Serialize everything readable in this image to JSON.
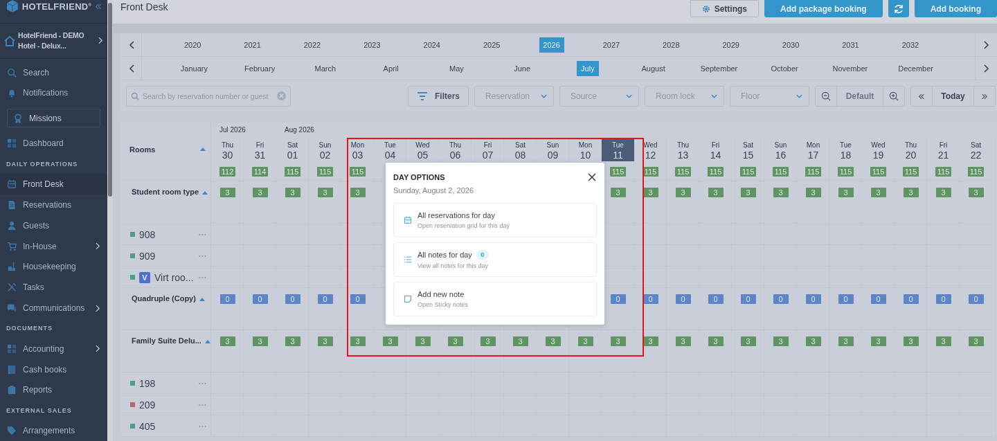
{
  "sidebar": {
    "brand": "HOTELFRIEND$^{®}$",
    "hotel": "HotelFriend - DEMO Hotel - Delux...",
    "items": [
      {
        "kind": "link",
        "label": "Search",
        "selected": false,
        "submenu": false
      },
      {
        "kind": "link",
        "label": "Notifications",
        "selected": false,
        "submenu": false
      },
      {
        "kind": "feature",
        "label": "Missions",
        "selected": false,
        "submenu": false
      },
      {
        "kind": "link",
        "label": "Dashboard",
        "selected": false,
        "submenu": false
      },
      {
        "kind": "heading",
        "label": "DAILY OPERATIONS"
      },
      {
        "kind": "link",
        "label": "Front Desk",
        "selected": true,
        "submenu": false
      },
      {
        "kind": "link",
        "label": "Reservations",
        "selected": false,
        "submenu": false
      },
      {
        "kind": "link",
        "label": "Guests",
        "selected": false,
        "submenu": false
      },
      {
        "kind": "link",
        "label": "In-House",
        "selected": false,
        "submenu": true
      },
      {
        "kind": "link",
        "label": "Housekeeping",
        "selected": false,
        "submenu": false
      },
      {
        "kind": "link",
        "label": "Tasks",
        "selected": false,
        "submenu": false
      },
      {
        "kind": "link",
        "label": "Communications",
        "selected": false,
        "submenu": true
      },
      {
        "kind": "heading",
        "label": "DOCUMENTS"
      },
      {
        "kind": "link",
        "label": "Accounting",
        "selected": false,
        "submenu": true
      },
      {
        "kind": "link",
        "label": "Cash books",
        "selected": false,
        "submenu": false
      },
      {
        "kind": "link",
        "label": "Reports",
        "selected": false,
        "submenu": false
      },
      {
        "kind": "heading",
        "label": "EXTERNAL SALES"
      },
      {
        "kind": "link",
        "label": "Arrangements",
        "selected": false,
        "submenu": false
      }
    ]
  },
  "header": {
    "title": "Front Desk",
    "buttons": [
      {
        "kind": "outline",
        "label": "Settings"
      },
      {
        "kind": "primary",
        "label": "Add package booking"
      },
      {
        "kind": "icon"
      },
      {
        "kind": "primary",
        "label": "Add booking"
      }
    ]
  },
  "years": [
    {
      "label": "2020",
      "selected": false
    },
    {
      "label": "2021",
      "selected": false
    },
    {
      "label": "2022",
      "selected": false
    },
    {
      "label": "2023",
      "selected": false
    },
    {
      "label": "2024",
      "selected": false
    },
    {
      "label": "2025",
      "selected": false
    },
    {
      "label": "2026",
      "selected": true
    },
    {
      "label": "2027",
      "selected": false
    },
    {
      "label": "2028",
      "selected": false
    },
    {
      "label": "2029",
      "selected": false
    },
    {
      "label": "2030",
      "selected": false
    },
    {
      "label": "2031",
      "selected": false
    },
    {
      "label": "2032",
      "selected": false
    }
  ],
  "months": [
    {
      "label": "January",
      "selected": false
    },
    {
      "label": "February",
      "selected": false
    },
    {
      "label": "March",
      "selected": false
    },
    {
      "label": "April",
      "selected": false
    },
    {
      "label": "May",
      "selected": false
    },
    {
      "label": "June",
      "selected": false
    },
    {
      "label": "July",
      "selected": true
    },
    {
      "label": "August",
      "selected": false
    },
    {
      "label": "September",
      "selected": false
    },
    {
      "label": "October",
      "selected": false
    },
    {
      "label": "November",
      "selected": false
    },
    {
      "label": "December",
      "selected": false
    }
  ],
  "filters": {
    "search": {
      "placeholder": "Search by reservation number or guest"
    },
    "filter_button": "Filters",
    "dropdowns": [
      {
        "placeholder": "Reservation"
      },
      {
        "placeholder": "Source"
      },
      {
        "placeholder": "Room lock"
      },
      {
        "placeholder": "Floor"
      }
    ],
    "zoom_label": "Default",
    "today_label": "Today"
  },
  "grid": {
    "rooms_header": "Rooms",
    "days": [
      {
        "month": "Jul 2026",
        "weekday": "Thu",
        "day": "30",
        "selected": false
      },
      {
        "weekday": "Fri",
        "day": "31",
        "selected": false
      },
      {
        "month": "Aug 2026",
        "weekday": "Sat",
        "day": "01",
        "selected": false
      },
      {
        "weekday": "Sun",
        "day": "02",
        "selected": false
      },
      {
        "weekday": "Mon",
        "day": "03",
        "selected": false
      },
      {
        "weekday": "Tue",
        "day": "04",
        "selected": false
      },
      {
        "weekday": "Wed",
        "day": "05",
        "selected": false
      },
      {
        "weekday": "Thu",
        "day": "06",
        "selected": false
      },
      {
        "weekday": "Fri",
        "day": "07",
        "selected": false
      },
      {
        "weekday": "Sat",
        "day": "08",
        "selected": false
      },
      {
        "weekday": "Sun",
        "day": "09",
        "selected": false
      },
      {
        "weekday": "Mon",
        "day": "10",
        "selected": false
      },
      {
        "weekday": "Tue",
        "day": "11",
        "selected": true
      },
      {
        "weekday": "Wed",
        "day": "12",
        "selected": false
      },
      {
        "weekday": "Thu",
        "day": "13",
        "selected": false
      },
      {
        "weekday": "Fri",
        "day": "14",
        "selected": false
      },
      {
        "weekday": "Sat",
        "day": "15",
        "selected": false
      },
      {
        "weekday": "Sun",
        "day": "16",
        "selected": false
      },
      {
        "weekday": "Mon",
        "day": "17",
        "selected": false
      },
      {
        "weekday": "Tue",
        "day": "18",
        "selected": false
      },
      {
        "weekday": "Wed",
        "day": "19",
        "selected": false
      },
      {
        "weekday": "Thu",
        "day": "20",
        "selected": false
      },
      {
        "weekday": "Fri",
        "day": "21",
        "selected": false
      },
      {
        "weekday": "Sat",
        "day": "22",
        "selected": false
      }
    ],
    "totals": [
      "112",
      "114",
      "115",
      "115",
      "115",
      "115",
      "115",
      "115",
      "115",
      "115",
      "115",
      "115",
      "115",
      "115",
      "115",
      "115",
      "115"
    ],
    "rows": [
      {
        "kind": "type",
        "name": "Student room type",
        "color": "#5e9562",
        "counts": [
          "3",
          "3",
          "3",
          "3",
          "3",
          "3",
          "3",
          "3",
          "3",
          "3",
          "3",
          "3",
          "3",
          "3",
          "3",
          "3",
          "3"
        ]
      },
      {
        "kind": "room",
        "name": "908",
        "color": "#4f9c8c"
      },
      {
        "kind": "room",
        "name": "909",
        "color": "#4f9c8c"
      },
      {
        "kind": "room",
        "name": "Virt roo...",
        "color": "#4f9c8c",
        "badge": "V"
      },
      {
        "kind": "type",
        "name": "Quadruple (Copy)",
        "color": "#5c86c9",
        "counts": [
          "0",
          "0",
          "0",
          "0",
          "0",
          "0",
          "0",
          "0",
          "0",
          "0",
          "0",
          "0",
          "0",
          "0",
          "0",
          "0",
          "0"
        ]
      },
      {
        "kind": "type",
        "name": "Family Suite Delu...",
        "color": "#5e9562",
        "counts": [
          "3",
          "3",
          "3",
          "3",
          "3",
          "3",
          "3",
          "3",
          "3",
          "3",
          "3",
          "3",
          "3",
          "3",
          "3",
          "3",
          "3",
          "3",
          "3",
          "3",
          "3",
          "3",
          "3",
          "3"
        ]
      },
      {
        "kind": "room",
        "name": "198",
        "color": "#4f9c8c"
      },
      {
        "kind": "room",
        "name": "209",
        "color": "#c2636b"
      },
      {
        "kind": "room",
        "name": "405",
        "color": "#4f9c8c"
      }
    ]
  },
  "dialog": {
    "title": "DAY OPTIONS",
    "date": "Sunday, August 2, 2026",
    "options": [
      {
        "title": "All reservations for day",
        "subtitle": "Open reservation grid for this day"
      },
      {
        "title": "All notes for day",
        "badge": "0",
        "subtitle": "View all notes for this day"
      },
      {
        "title": "Add new note",
        "subtitle": "Open Sticky notes"
      }
    ]
  }
}
